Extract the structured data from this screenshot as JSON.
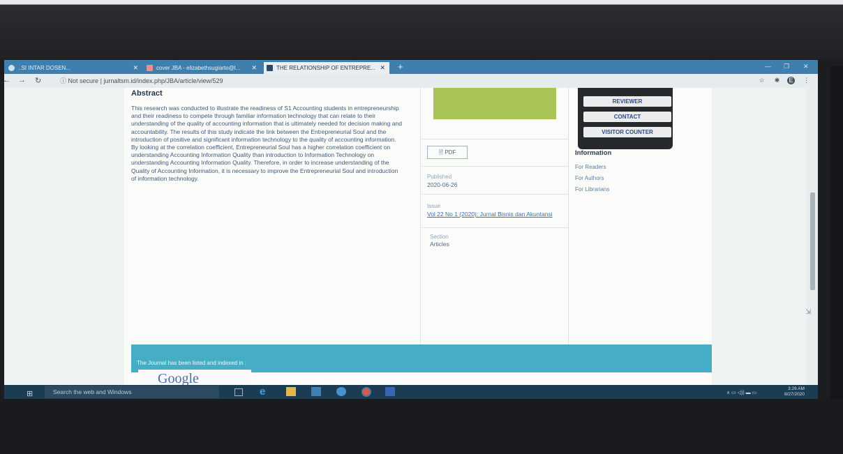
{
  "browser": {
    "tabs": [
      {
        "label": "..SI INTAR DOSEN...",
        "active": false
      },
      {
        "label": "cover JBA - elizabethsugiarto@l...",
        "active": false
      },
      {
        "label": "THE RELATIONSHIP OF ENTREPRE...",
        "active": true
      }
    ],
    "new_tab": "+",
    "security": "Not secure",
    "url": "jurnaltsm.id/index.php/JBA/article/view/529"
  },
  "article": {
    "abstract_heading": "Abstract",
    "abstract_text": "This research was conducted to illustrate the readiness of S1 Accounting students in entrepreneurship and their readiness to compete through familiar information technology that can relate to their understanding of the quality of accounting information that is ultimately needed for decision making and accountability. The results of this study indicate the link between the Entrepreneurial Soul and the introduction of positive and significant information technology to the quality of accounting information. By looking at the correlation coefficient, Entrepreneurial Soul has a higher correlation coefficient on understanding Accounting Information Quality than introduction to Information Technology on understanding Accounting Information Quality. Therefore, in order to increase understanding of the Quality of Accounting Information, it is necessary to improve the Entrepreneurial Soul and introduction of information technology."
  },
  "details": {
    "pdf_label": "PDF",
    "published_label": "Published",
    "published_date": "2020-06-26",
    "issue_label": "Issue",
    "issue_value": "Vol 22 No 1 (2020): Jurnal Bisnis dan Akuntansi",
    "section_label": "Section",
    "section_value": "Articles"
  },
  "sidebar": {
    "buttons": [
      "REVIEWER",
      "CONTACT",
      "VISITOR COUNTER"
    ],
    "information_title": "Information",
    "information_links": [
      "For Readers",
      "For Authors",
      "For Librarians"
    ]
  },
  "footer": {
    "indexed_text": "The Journal has been listed and indexed in :",
    "google_logo_text": "Google"
  },
  "taskbar": {
    "search_placeholder": "Search the web and Windows",
    "time": "3:26 AM",
    "date": "8/27/2020"
  },
  "colors": {
    "tabbar": "#3f7fae",
    "footer_band": "#46aec4",
    "cover_image": "#a8c455",
    "taskbar": "#1c3c54"
  }
}
